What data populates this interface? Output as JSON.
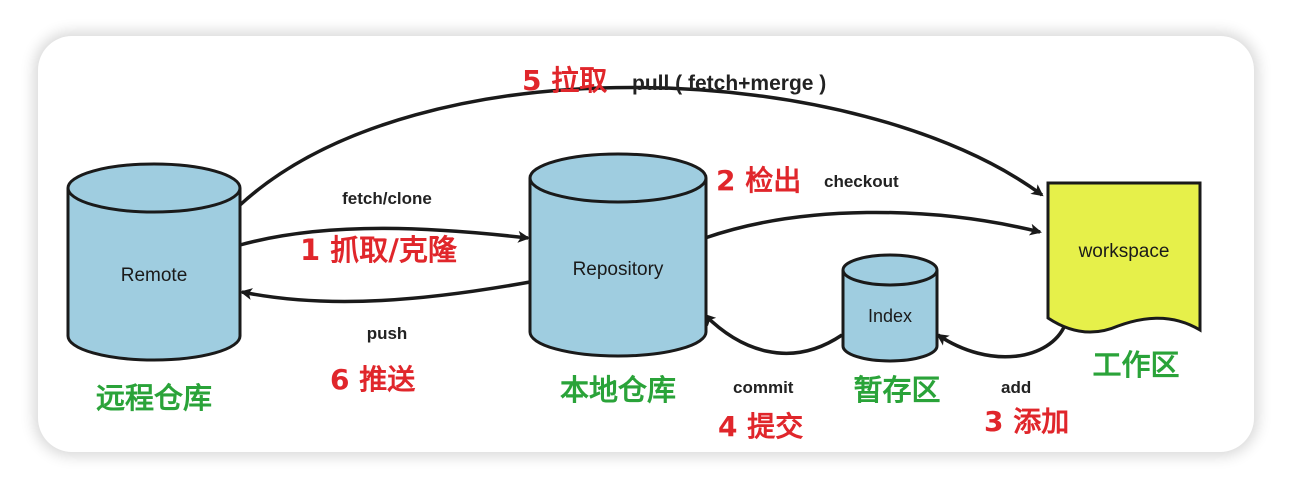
{
  "nodes": {
    "remote": {
      "label": "Remote",
      "caption": "远程仓库"
    },
    "repository": {
      "label": "Repository",
      "caption": "本地仓库"
    },
    "index": {
      "label": "Index",
      "caption": "暂存区"
    },
    "workspace": {
      "label": "workspace",
      "caption": "工作区"
    }
  },
  "steps": {
    "pull": {
      "number_label": "5 拉取",
      "command": "pull ( fetch+merge )"
    },
    "fetch": {
      "command": "fetch/clone",
      "number_label": "1 抓取/克隆"
    },
    "checkout": {
      "number_label": "2 检出",
      "command": "checkout"
    },
    "push": {
      "command": "push",
      "number_label": "6 推送"
    },
    "commit": {
      "command": "commit",
      "number_label": "4 提交"
    },
    "add": {
      "command": "add",
      "number_label": "3 添加"
    }
  },
  "colors": {
    "cylinder_fill": "#9fcde0",
    "workspace_fill": "#e6f04a",
    "step_red": "#e0262b",
    "caption_green": "#2aa339"
  }
}
